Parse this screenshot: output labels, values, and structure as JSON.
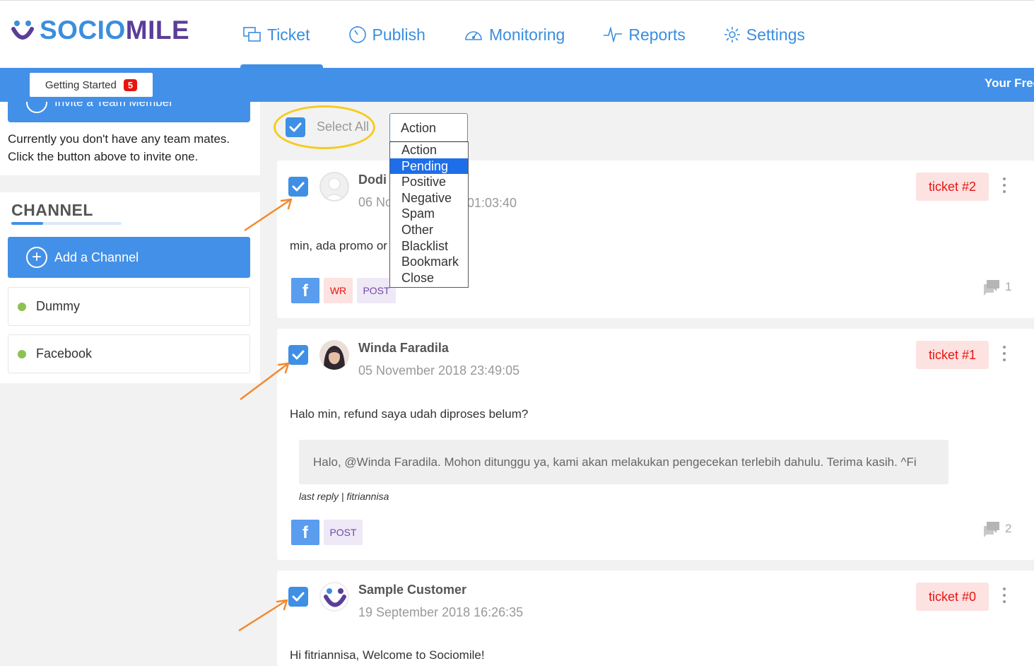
{
  "brand": {
    "name_part1": "SOCIO",
    "name_part2": "MILE"
  },
  "nav": [
    {
      "label": "Ticket",
      "icon": "ticket-icon",
      "active": true
    },
    {
      "label": "Publish",
      "icon": "publish-icon"
    },
    {
      "label": "Monitoring",
      "icon": "monitoring-icon"
    },
    {
      "label": "Reports",
      "icon": "reports-icon"
    },
    {
      "label": "Settings",
      "icon": "gear-icon"
    }
  ],
  "banner": {
    "getting_started_label": "Getting Started",
    "getting_started_count": "5",
    "trial_text": "Your Free"
  },
  "sidebar": {
    "invite_label": "Invite a Team Member",
    "team_empty_text": "Currently you don't have any team mates. Click the button above to invite one.",
    "channel_title": "CHANNEL",
    "add_channel_label": "Add a Channel",
    "channels": [
      {
        "label": "Dummy",
        "status_color": "#8dc252"
      },
      {
        "label": "Facebook",
        "status_color": "#8dc252"
      }
    ]
  },
  "toolbar": {
    "select_all_label": "Select All",
    "action_selected": "Action",
    "action_options": [
      "Action",
      "Pending",
      "Positive",
      "Negative",
      "Spam",
      "Other",
      "Blacklist",
      "Bookmark",
      "Close"
    ],
    "highlighted_option": "Pending"
  },
  "tickets": [
    {
      "name": "Dodi",
      "date_start": "06 No",
      "date_end": "01:03:40",
      "ticket": "ticket #2",
      "message": "min, ada promo or",
      "tags": [
        "WR",
        "POST"
      ],
      "comments": "1"
    },
    {
      "name": "Winda Faradila",
      "date": "05 November 2018 23:49:05",
      "ticket": "ticket #1",
      "message": "Halo min, refund saya udah diproses belum?",
      "reply": "Halo, @Winda Faradila. Mohon ditunggu ya, kami akan melakukan pengecekan terlebih dahulu. Terima kasih. ^Fi",
      "last_reply": "last reply | fitriannisa",
      "tags": [
        "POST"
      ],
      "comments": "2"
    },
    {
      "name": "Sample Customer",
      "date": "19 September 2018 16:26:35",
      "ticket": "ticket #0",
      "message": "Hi fitriannisa, Welcome to Sociomile!"
    }
  ],
  "colors": {
    "primary": "#4390e8",
    "badge_red": "#e8140f",
    "highlight_ellipse": "#f4cc1e",
    "annotation_arrow": "#f28a2e"
  }
}
